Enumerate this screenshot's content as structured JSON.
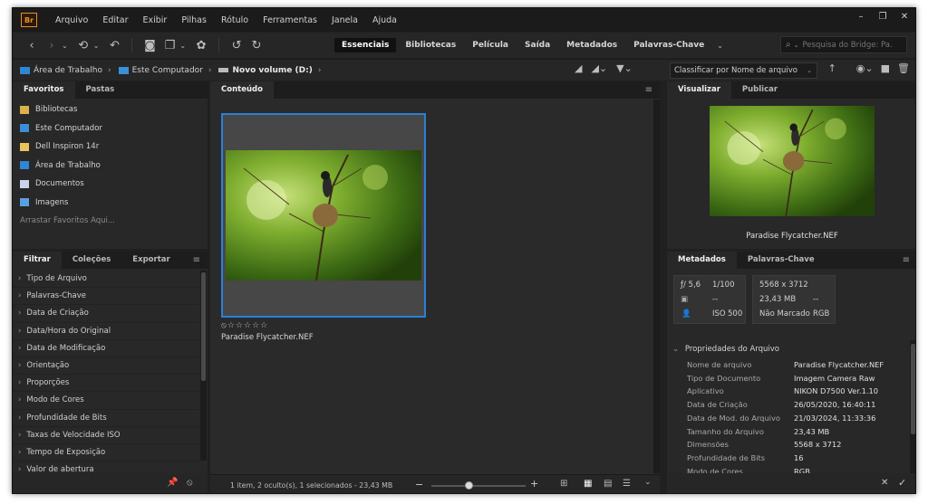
{
  "app": {
    "logo": "Br"
  },
  "menu": [
    "Arquivo",
    "Editar",
    "Exibir",
    "Pilhas",
    "Rótulo",
    "Ferramentas",
    "Janela",
    "Ajuda"
  ],
  "window_controls": [
    "–",
    "❐",
    "✕"
  ],
  "workspaces": [
    {
      "label": "Essenciais",
      "active": true
    },
    {
      "label": "Bibliotecas"
    },
    {
      "label": "Película"
    },
    {
      "label": "Saída"
    },
    {
      "label": "Metadados"
    },
    {
      "label": "Palavras-Chave"
    }
  ],
  "search": {
    "placeholder": "Pesquisa do Bridge: Pa..."
  },
  "breadcrumb": [
    "Área de Trabalho",
    "Este Computador",
    "Novo volume (D:)"
  ],
  "sort": {
    "label": "Classificar por Nome de arquivo"
  },
  "left_top_tabs": [
    "Favoritos",
    "Pastas"
  ],
  "favorites": [
    {
      "label": "Bibliotecas",
      "color": "#d9b24a"
    },
    {
      "label": "Este Computador",
      "color": "#3a8fd8"
    },
    {
      "label": "Dell Inspiron 14r",
      "color": "#e8c55a"
    },
    {
      "label": "Área de Trabalho",
      "color": "#2f86d6"
    },
    {
      "label": "Documentos",
      "color": "#c8d4e8"
    },
    {
      "label": "Imagens",
      "color": "#5aa0e0"
    }
  ],
  "favorites_hint": "Arrastar Favoritos Aqui...",
  "left_bottom_tabs": [
    "Filtrar",
    "Coleções",
    "Exportar"
  ],
  "filters": [
    "Tipo de Arquivo",
    "Palavras-Chave",
    "Data de Criação",
    "Data/Hora do Original",
    "Data de Modificação",
    "Orientação",
    "Proporções",
    "Modo de Cores",
    "Profundidade de Bits",
    "Taxas de Velocidade ISO",
    "Tempo de Exposição",
    "Valor de abertura"
  ],
  "content": {
    "tab": "Conteúdo",
    "item_label": "Paradise Flycatcher.NEF",
    "stars": "⦸☆☆☆☆☆",
    "status": "1 item, 2 oculto(s), 1 selecionados - 23,43 MB"
  },
  "preview": {
    "tabs": [
      "Visualizar",
      "Publicar"
    ],
    "caption": "Paradise Flycatcher.NEF"
  },
  "metadata": {
    "tabs": [
      "Metadados",
      "Palavras-Chave"
    ],
    "aperture": "ƒ/ 5,6",
    "shutter": "1/100",
    "metering": "--",
    "iso_label": "ISO",
    "iso": "500",
    "dimensions": "5568 x 3712",
    "size": "23,43 MB",
    "size_extra": "--",
    "label_status": "Não Marcado",
    "color_mode": "RGB",
    "section": "Propriedades do Arquivo",
    "props": [
      {
        "k": "Nome de arquivo",
        "v": "Paradise Flycatcher.NEF"
      },
      {
        "k": "Tipo de Documento",
        "v": "Imagem Camera Raw"
      },
      {
        "k": "Aplicativo",
        "v": "NIKON D7500 Ver.1.10"
      },
      {
        "k": "Data de Criação",
        "v": "26/05/2020, 16:40:11"
      },
      {
        "k": "Data de Mod. do Arquivo",
        "v": "21/03/2024, 11:33:36"
      },
      {
        "k": "Tamanho do Arquivo",
        "v": "23,43 MB"
      },
      {
        "k": "Dimensões",
        "v": "5568 x 3712"
      },
      {
        "k": "Profundidade de Bits",
        "v": "16"
      },
      {
        "k": "Modo de Cores",
        "v": "RGB"
      }
    ]
  },
  "zoom_level": 0.4
}
